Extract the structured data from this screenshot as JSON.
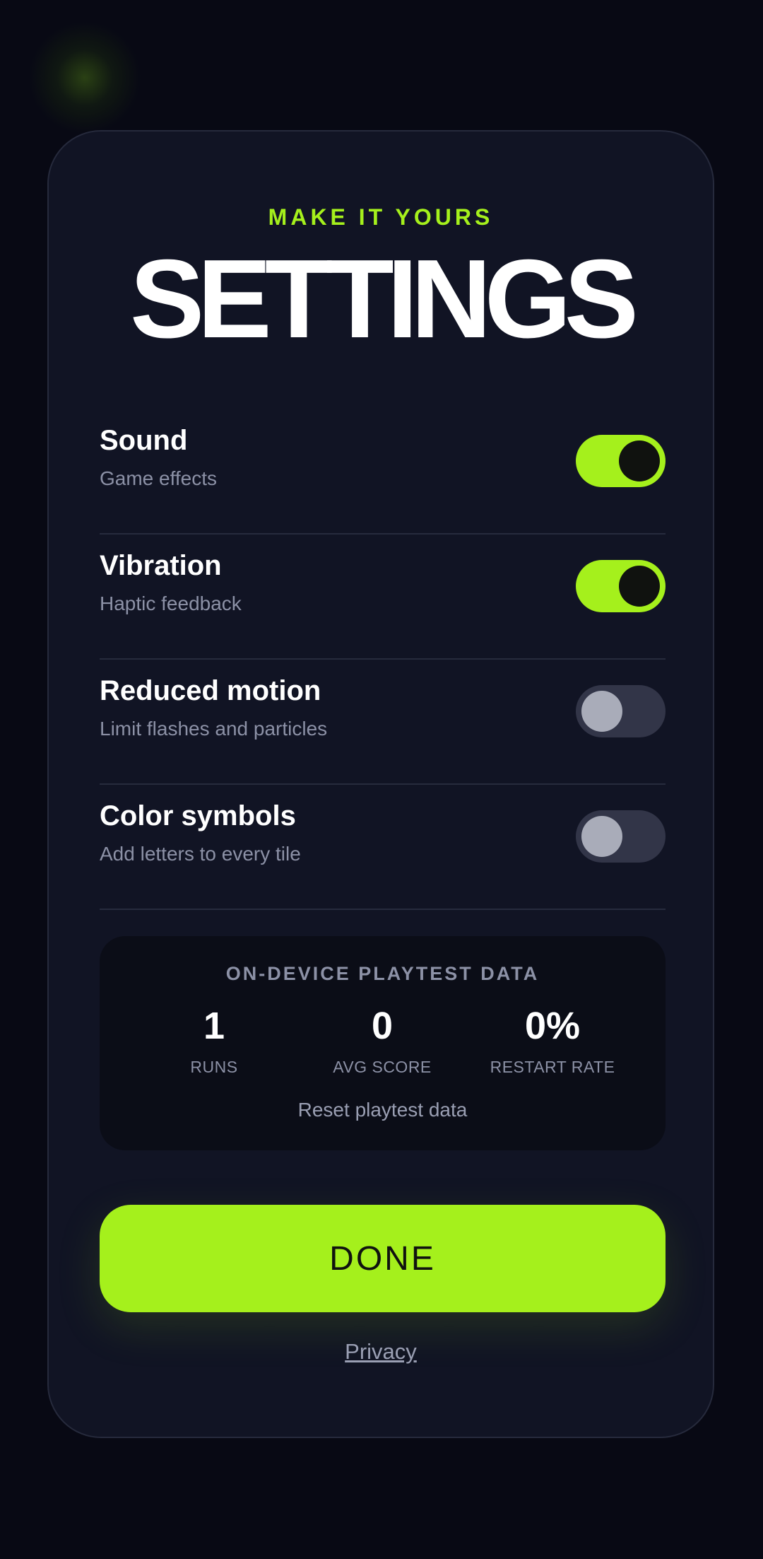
{
  "header": {
    "eyebrow": "MAKE IT YOURS",
    "title": "SETTINGS"
  },
  "settings": [
    {
      "name": "Sound",
      "description": "Game effects",
      "enabled": true
    },
    {
      "name": "Vibration",
      "description": "Haptic feedback",
      "enabled": true
    },
    {
      "name": "Reduced motion",
      "description": "Limit flashes and particles",
      "enabled": false
    },
    {
      "name": "Color symbols",
      "description": "Add letters to every tile",
      "enabled": false
    }
  ],
  "playtest": {
    "title": "ON-DEVICE PLAYTEST DATA",
    "stats": [
      {
        "value": "1",
        "label": "RUNS"
      },
      {
        "value": "0",
        "label": "AVG SCORE"
      },
      {
        "value": "0%",
        "label": "RESTART RATE"
      }
    ],
    "reset_label": "Reset playtest data"
  },
  "actions": {
    "done_label": "DONE",
    "privacy_label": "Privacy"
  },
  "colors": {
    "accent": "#a5f01c",
    "background": "#080914",
    "card": "#111424",
    "muted_text": "#8c91a6"
  }
}
